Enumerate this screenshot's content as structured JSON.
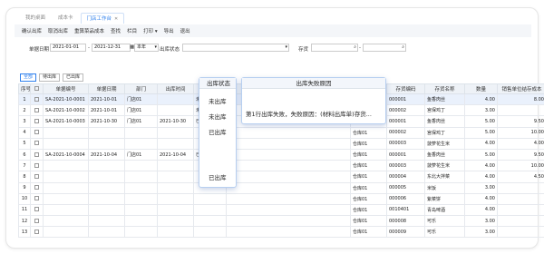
{
  "tabs": [
    {
      "label": "我的桌面"
    },
    {
      "label": "成本卡"
    },
    {
      "label": "门店工作台",
      "active": true
    }
  ],
  "toolbar": [
    "确认出库",
    "取消出库",
    "重算菜品成本",
    "查找",
    "栏目",
    "打印",
    "导出",
    "退出"
  ],
  "filters": {
    "date_label": "单据日期",
    "date_from": "2021-01-01",
    "date_sep": "-",
    "date_to": "2021-12-31",
    "date_unit": "本年",
    "status_label": "出库状态",
    "status_value": "",
    "warehouse_label": "存货",
    "warehouse_value": ""
  },
  "subtabs": [
    "全部",
    "待出库",
    "已出库"
  ],
  "columns": [
    "序号",
    "",
    "单据编号",
    "单据日期",
    "部门",
    "出库时间",
    "出库状态",
    "出库失败原因",
    "仓库",
    "存货编码",
    "存货名称",
    "数量",
    "销售单位结存成本"
  ],
  "rows": [
    {
      "n": "1",
      "no": "SA-2021-10-0001",
      "date": "2021-10-01",
      "dept": "门店01",
      "time": "",
      "status": "未出库",
      "reason": "",
      "wh": "仓库01",
      "code": "000001",
      "name": "鱼香肉丝",
      "qty": "4.00",
      "cost": "8.00",
      "sel": true
    },
    {
      "n": "2",
      "no": "SA-2021-10-0002",
      "date": "2021-10-01",
      "dept": "门店01",
      "time": "",
      "status": "未出库",
      "reason": "",
      "wh": "仓库01",
      "code": "000002",
      "name": "宫保鸡丁",
      "qty": "3.00",
      "cost": "",
      "sel": false
    },
    {
      "n": "3",
      "no": "SA-2021-10-0003",
      "date": "2021-10-30",
      "dept": "门店01",
      "time": "2021-10-30",
      "status": "已出库",
      "reason": "",
      "wh": "仓库01",
      "code": "000001",
      "name": "鱼香肉丝",
      "qty": "5.00",
      "cost": "9.50",
      "sel": false
    },
    {
      "n": "4",
      "no": "",
      "date": "",
      "dept": "",
      "time": "",
      "status": "",
      "reason": "",
      "wh": "仓库01",
      "code": "000002",
      "name": "宫保鸡丁",
      "qty": "5.00",
      "cost": "10.00",
      "sel": false
    },
    {
      "n": "5",
      "no": "",
      "date": "",
      "dept": "",
      "time": "",
      "status": "",
      "reason": "",
      "wh": "仓库01",
      "code": "000003",
      "name": "菠萝花生米",
      "qty": "4.00",
      "cost": "4.00",
      "sel": false
    },
    {
      "n": "6",
      "no": "SA-2021-10-0004",
      "date": "2021-10-04",
      "dept": "门店01",
      "time": "2021-10-04",
      "status": "已出库",
      "reason": "",
      "wh": "仓库01",
      "code": "000001",
      "name": "鱼香肉丝",
      "qty": "5.00",
      "cost": "9.50",
      "sel": false
    },
    {
      "n": "7",
      "no": "",
      "date": "",
      "dept": "",
      "time": "",
      "status": "",
      "reason": "",
      "wh": "仓库01",
      "code": "000003",
      "name": "菠萝花生米",
      "qty": "4.00",
      "cost": "10.00",
      "sel": false
    },
    {
      "n": "8",
      "no": "",
      "date": "",
      "dept": "",
      "time": "",
      "status": "",
      "reason": "",
      "wh": "仓库01",
      "code": "000004",
      "name": "东北大拌菜",
      "qty": "4.00",
      "cost": "4.50",
      "sel": false
    },
    {
      "n": "9",
      "no": "",
      "date": "",
      "dept": "",
      "time": "",
      "status": "",
      "reason": "",
      "wh": "仓库01",
      "code": "000005",
      "name": "米饭",
      "qty": "3.00",
      "cost": "",
      "sel": false
    },
    {
      "n": "10",
      "no": "",
      "date": "",
      "dept": "",
      "time": "",
      "status": "",
      "reason": "",
      "wh": "仓库01",
      "code": "000006",
      "name": "紫菜饼",
      "qty": "4.00",
      "cost": "",
      "sel": false
    },
    {
      "n": "11",
      "no": "",
      "date": "",
      "dept": "",
      "time": "",
      "status": "",
      "reason": "",
      "wh": "仓库01",
      "code": "0010401",
      "name": "青岛啤酒",
      "qty": "4.00",
      "cost": "",
      "sel": false
    },
    {
      "n": "12",
      "no": "",
      "date": "",
      "dept": "",
      "time": "",
      "status": "",
      "reason": "",
      "wh": "仓库01",
      "code": "000008",
      "name": "可乐",
      "qty": "3.00",
      "cost": "",
      "sel": false
    },
    {
      "n": "13",
      "no": "",
      "date": "",
      "dept": "",
      "time": "",
      "status": "",
      "reason": "",
      "wh": "仓库01",
      "code": "000009",
      "name": "可乐",
      "qty": "3.00",
      "cost": "",
      "sel": false
    }
  ],
  "popup_status": {
    "header": "出库状态",
    "items": [
      "未出库",
      "未出库",
      "已出库",
      "已出库"
    ]
  },
  "popup_reason": {
    "header": "出库失败原因",
    "text": "第1行出库失败，失败原因：(材料出库单)存货..."
  }
}
